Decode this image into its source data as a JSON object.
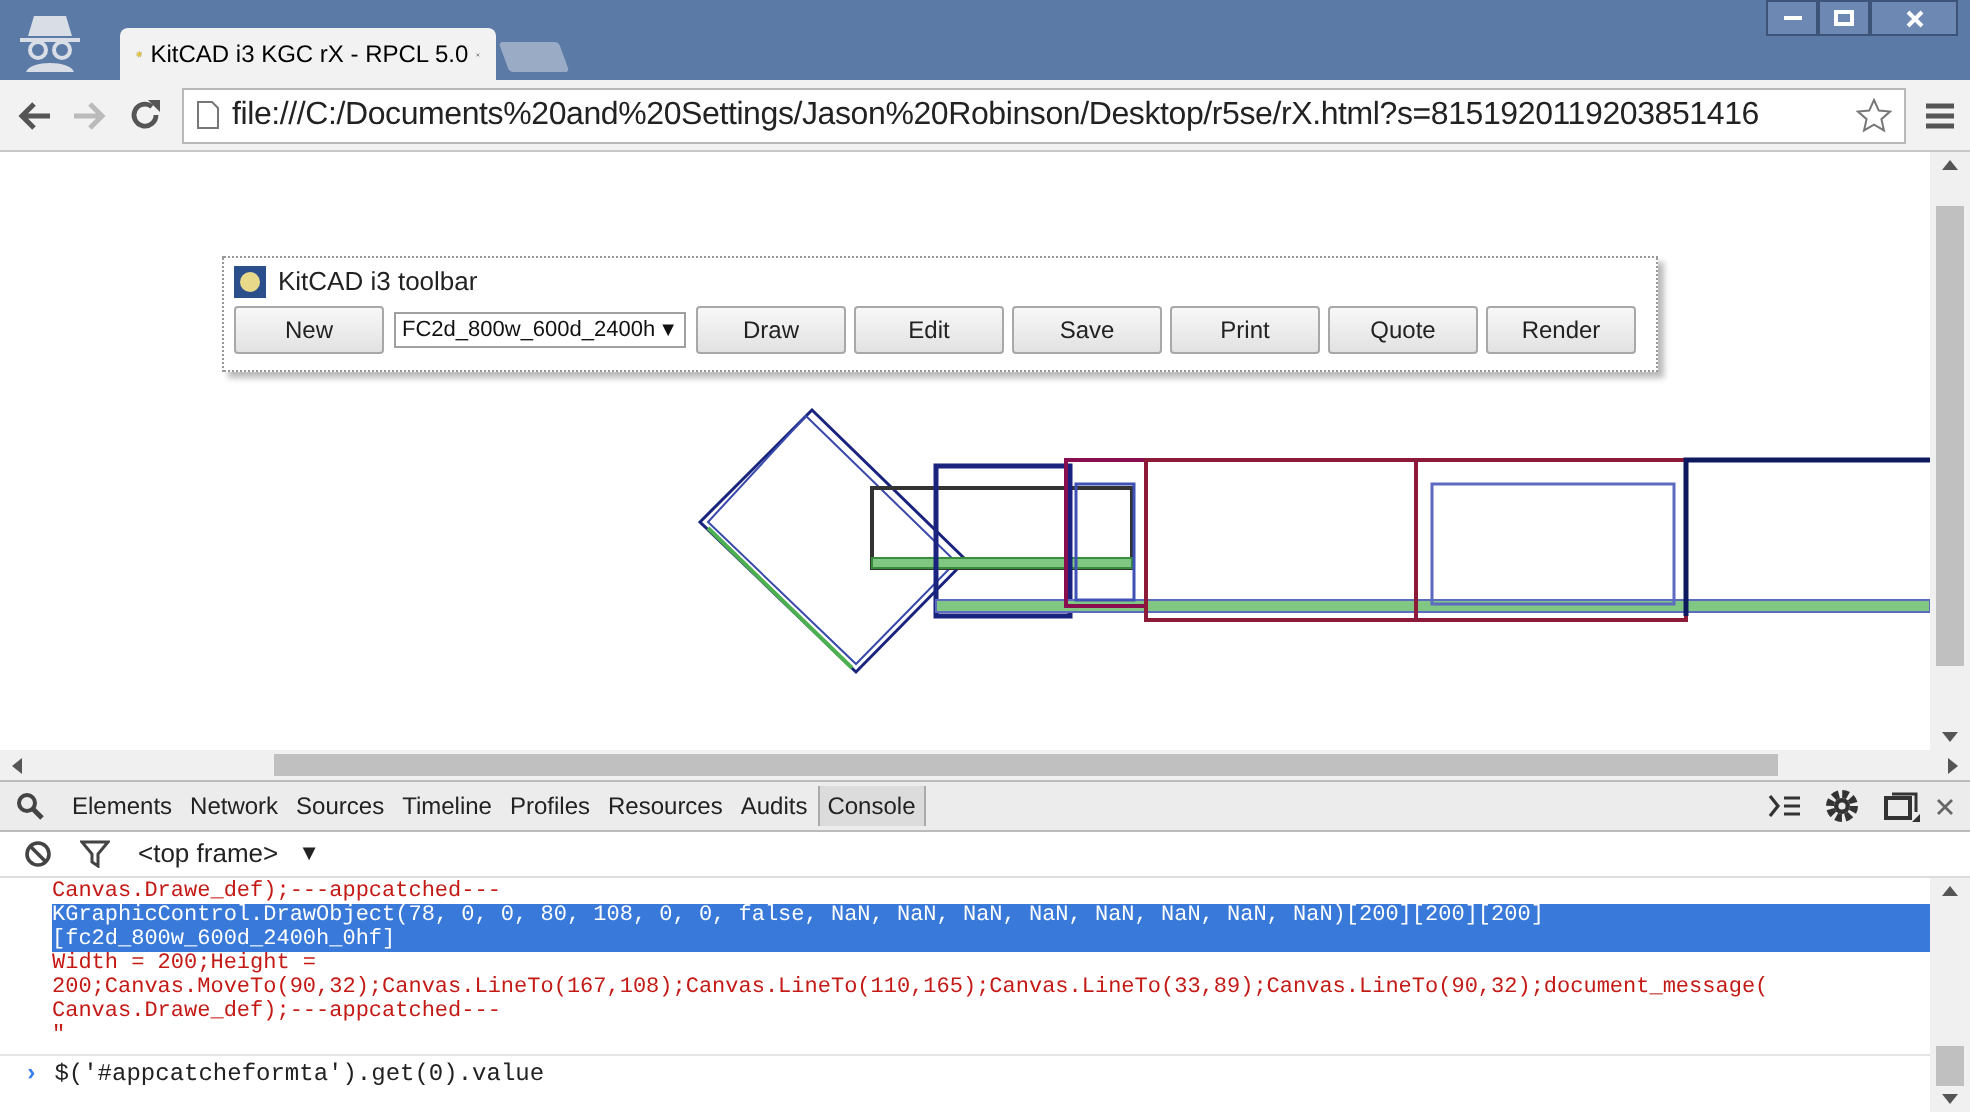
{
  "browser": {
    "tab_title": "KitCAD i3 KGC rX - RPCL 5.0",
    "address": "file:///C:/Documents%20and%20Settings/Jason%20Robinson/Desktop/r5se/rX.html?s=8151920119203851416"
  },
  "toolbar": {
    "title": "KitCAD i3 toolbar",
    "items": [
      {
        "kind": "button",
        "label": "New"
      },
      {
        "kind": "select",
        "value": "FC2d_800w_600d_2400h",
        "arrow": "▼"
      },
      {
        "kind": "button",
        "label": "Draw"
      },
      {
        "kind": "button",
        "label": "Edit"
      },
      {
        "kind": "button",
        "label": "Save"
      },
      {
        "kind": "button",
        "label": "Print"
      },
      {
        "kind": "button",
        "label": "Quote"
      },
      {
        "kind": "button",
        "label": "Render"
      }
    ]
  },
  "devtools": {
    "tabs": [
      {
        "label": "Elements",
        "selected": false
      },
      {
        "label": "Network",
        "selected": false
      },
      {
        "label": "Sources",
        "selected": false
      },
      {
        "label": "Timeline",
        "selected": false
      },
      {
        "label": "Profiles",
        "selected": false
      },
      {
        "label": "Resources",
        "selected": false
      },
      {
        "label": "Audits",
        "selected": false
      },
      {
        "label": "Console",
        "selected": true
      }
    ],
    "frame_selector": "<top frame>",
    "frame_arrow": "▼",
    "console_lines": [
      {
        "text": "Canvas.Drawe_def);---appcatched---",
        "selected": false
      },
      {
        "text": "KGraphicControl.DrawObject(78, 0, 0, 80, 108, 0, 0, false, NaN, NaN, NaN, NaN, NaN, NaN, NaN, NaN)[200][200][200]",
        "selected": true
      },
      {
        "text": "[fc2d_800w_600d_2400h_0hf]",
        "selected": true
      },
      {
        "text": "Width = 200;Height =",
        "selected": false
      },
      {
        "text": "200;Canvas.MoveTo(90,32);Canvas.LineTo(167,108);Canvas.LineTo(110,165);Canvas.LineTo(33,89);Canvas.LineTo(90,32);document_message(",
        "selected": false
      },
      {
        "text": "Canvas.Drawe_def);---appcatched---",
        "selected": false
      },
      {
        "text": "\"",
        "selected": false
      }
    ],
    "prompt": "›",
    "input": "$('#appcatcheformta').get(0).value"
  }
}
